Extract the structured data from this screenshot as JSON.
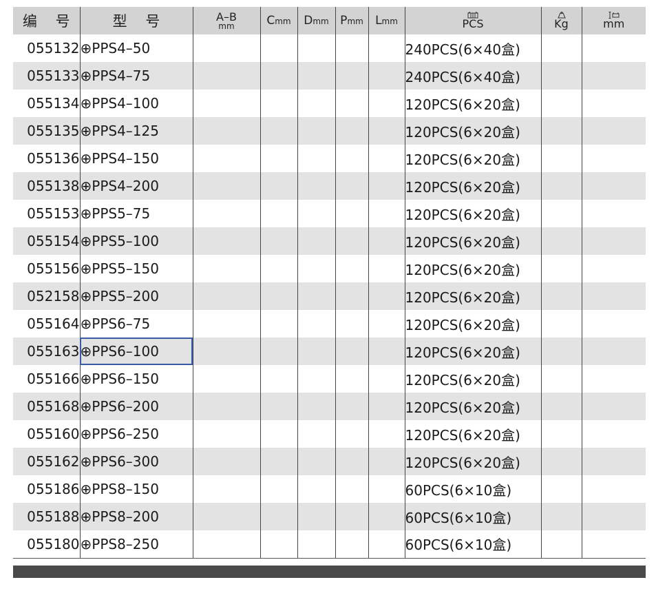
{
  "headers": {
    "code": "编 号",
    "model": "型 号",
    "ab_main": "A–B",
    "ab_sub": "mm",
    "c_letter": "C",
    "c_unit": "mm",
    "d_letter": "D",
    "d_unit": "mm",
    "p_letter": "P",
    "p_unit": "mm",
    "l_letter": "L",
    "l_unit": "mm",
    "pack_unit": "PCS",
    "weight_unit": "Kg",
    "size_unit": "mm"
  },
  "icons": {
    "pack": "box-icon",
    "weight": "weight-icon",
    "size": "box-dimension-icon"
  },
  "accent_color": "#3b5aa8",
  "rows": [
    {
      "code": "055132",
      "model": "⊕PPS4–50",
      "pack": "240PCS(6×40盒)"
    },
    {
      "code": "055133",
      "model": "⊕PPS4–75",
      "pack": "240PCS(6×40盒)"
    },
    {
      "code": "055134",
      "model": "⊕PPS4–100",
      "pack": "120PCS(6×20盒)"
    },
    {
      "code": "055135",
      "model": "⊕PPS4–125",
      "pack": "120PCS(6×20盒)"
    },
    {
      "code": "055136",
      "model": "⊕PPS4–150",
      "pack": "120PCS(6×20盒)"
    },
    {
      "code": "055138",
      "model": "⊕PPS4–200",
      "pack": "120PCS(6×20盒)"
    },
    {
      "code": "055153",
      "model": "⊕PPS5–75",
      "pack": "120PCS(6×20盒)"
    },
    {
      "code": "055154",
      "model": "⊕PPS5–100",
      "pack": "120PCS(6×20盒)"
    },
    {
      "code": "055156",
      "model": "⊕PPS5–150",
      "pack": "120PCS(6×20盒)"
    },
    {
      "code": "052158",
      "model": "⊕PPS5–200",
      "pack": "120PCS(6×20盒)"
    },
    {
      "code": "055164",
      "model": "⊕PPS6–75",
      "pack": "120PCS(6×20盒)"
    },
    {
      "code": "055163",
      "model": "⊕PPS6–100",
      "pack": "120PCS(6×20盒)"
    },
    {
      "code": "055166",
      "model": "⊕PPS6–150",
      "pack": "120PCS(6×20盒)"
    },
    {
      "code": "055168",
      "model": "⊕PPS6–200",
      "pack": "120PCS(6×20盒)"
    },
    {
      "code": "055160",
      "model": "⊕PPS6–250",
      "pack": "120PCS(6×20盒)"
    },
    {
      "code": "055162",
      "model": "⊕PPS6–300",
      "pack": "120PCS(6×20盒)"
    },
    {
      "code": "055186",
      "model": "⊕PPS8–150",
      "pack": "60PCS(6×10盒)"
    },
    {
      "code": "055188",
      "model": "⊕PPS8–200",
      "pack": "60PCS(6×10盒)"
    },
    {
      "code": "055180",
      "model": "⊕PPS8–250",
      "pack": "60PCS(6×10盒)"
    }
  ],
  "selected_model_code": "055163"
}
